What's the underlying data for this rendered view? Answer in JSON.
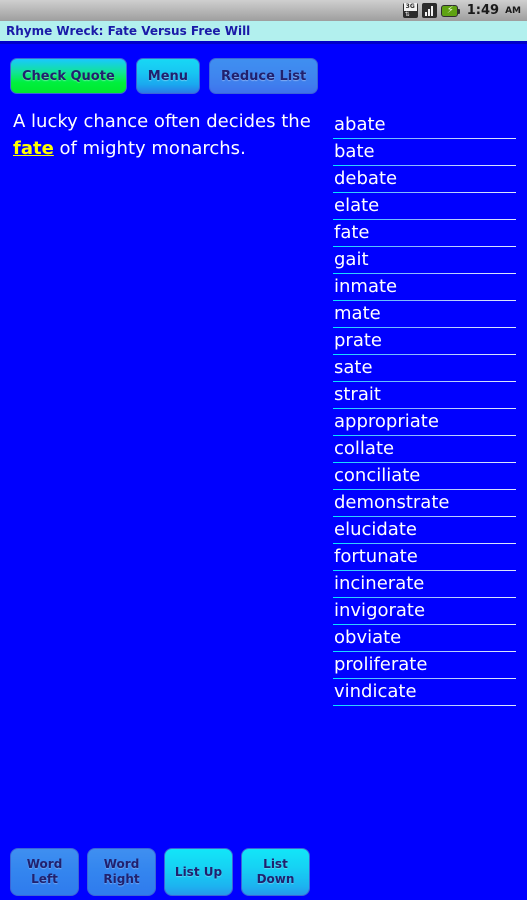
{
  "status_bar": {
    "network_label": "3G",
    "network_arrows": "⇅",
    "signal_icon": "signal-bars-icon",
    "battery_icon": "battery-charging-icon",
    "battery_bolt": "⚡",
    "time": "1:49",
    "ampm": "AM"
  },
  "title_bar": {
    "title": "Rhyme Wreck: Fate Versus Free Will"
  },
  "toolbar": {
    "buttons": [
      {
        "label": "Check Quote",
        "style": "green"
      },
      {
        "label": "Menu",
        "style": "cyan"
      },
      {
        "label": "Reduce List",
        "style": "muted"
      }
    ]
  },
  "quote": {
    "prefix": "A lucky chance often decides the ",
    "highlight": "fate",
    "suffix": " of mighty monarchs.",
    "full_text": "A lucky chance often decides the fate of mighty monarchs.",
    "highlight_color": "#ffff00"
  },
  "rhyme_list": {
    "words": [
      "abate",
      "bate",
      "debate",
      "elate",
      "fate",
      "gait",
      "inmate",
      "mate",
      "prate",
      "sate",
      "strait",
      "appropriate",
      "collate",
      "conciliate",
      "demonstrate",
      "elucidate",
      "fortunate",
      "incinerate",
      "invigorate",
      "obviate",
      "proliferate",
      "vindicate"
    ]
  },
  "bottom_bar": {
    "buttons": [
      {
        "line1": "Word",
        "line2": "Left",
        "style": "blue"
      },
      {
        "line1": "Word",
        "line2": "Right",
        "style": "blue"
      },
      {
        "line1": "List Up",
        "line2": "",
        "style": "aqua"
      },
      {
        "line1": "List",
        "line2": "Down",
        "style": "aqua"
      }
    ]
  },
  "colors": {
    "background": "#0000ff",
    "title_bar_bg": "#b2f0ee",
    "title_text": "#1a1aa8",
    "list_text": "#ffffff",
    "separator_start": "#00e5ff"
  }
}
